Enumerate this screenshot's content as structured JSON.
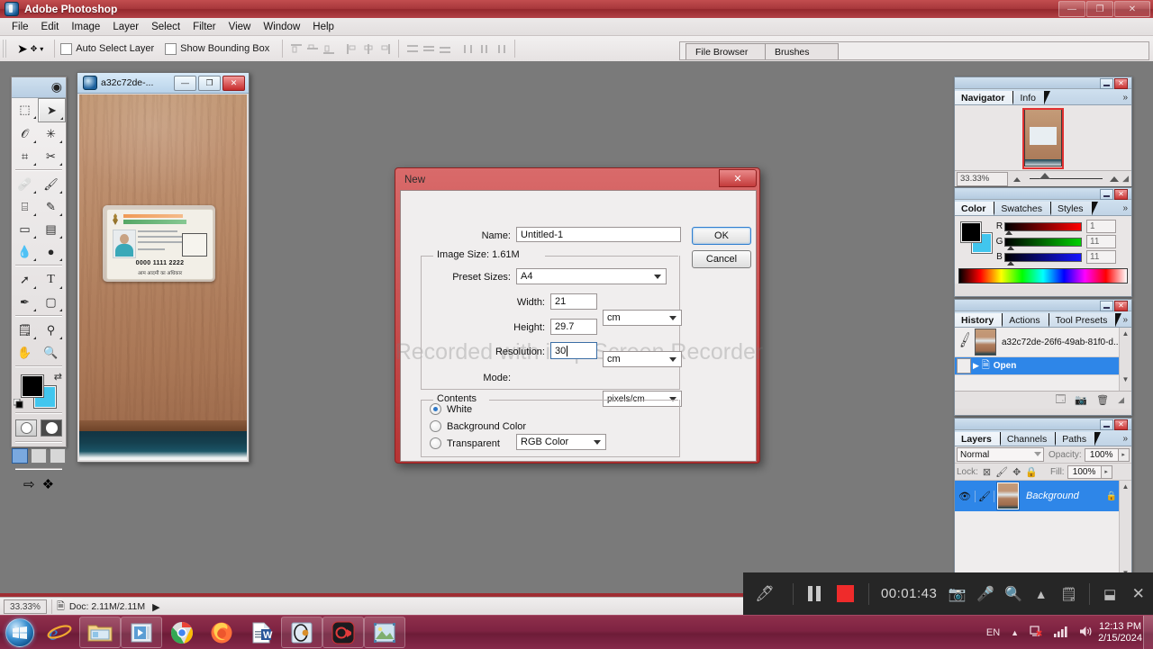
{
  "app": {
    "title": "Adobe Photoshop",
    "window_controls": {
      "minimize": "—",
      "restore": "❐",
      "close": "✕"
    },
    "menus": [
      "File",
      "Edit",
      "Image",
      "Layer",
      "Select",
      "Filter",
      "View",
      "Window",
      "Help"
    ]
  },
  "options_bar": {
    "auto_select_layer": "Auto Select Layer",
    "show_bounding_box": "Show Bounding Box"
  },
  "palette_well": {
    "tabs": [
      "File Browser",
      "Brushes"
    ]
  },
  "document": {
    "title": "a32c72de-...",
    "buttons": {
      "minimize": "—",
      "maximize": "❐",
      "close": "✕"
    },
    "id_card": {
      "number": "0000 1111 2222",
      "footer": "आम आदमी का अधिकार"
    }
  },
  "status_bar": {
    "zoom": "33.33%",
    "doc_info": "Doc: 2.11M/2.11M",
    "arrow": "▶"
  },
  "navigator": {
    "tabs": [
      "Navigator",
      "Info"
    ],
    "zoom": "33.33%",
    "more": "»"
  },
  "color": {
    "tabs": [
      "Color",
      "Swatches",
      "Styles"
    ],
    "more": "»",
    "channels": [
      {
        "label": "R",
        "value": "1"
      },
      {
        "label": "G",
        "value": "11"
      },
      {
        "label": "B",
        "value": "11"
      }
    ],
    "foreground_hex": "#000000",
    "background_hex": "#41c6ee"
  },
  "history": {
    "tabs": [
      "History",
      "Actions",
      "Tool Presets"
    ],
    "more": "»",
    "snapshot": "a32c72de-26f6-49ab-81f0-d...",
    "selected_state": "Open"
  },
  "layers": {
    "tabs": [
      "Layers",
      "Channels",
      "Paths"
    ],
    "more": "»",
    "blend_mode": "Normal",
    "opacity_label": "Opacity:",
    "opacity_value": "100%",
    "lock_label": "Lock:",
    "fill_label": "Fill:",
    "fill_value": "100%",
    "rows": [
      {
        "name": "Background",
        "locked": true
      }
    ]
  },
  "dialog": {
    "title": "New",
    "close": "✕",
    "name_label": "Name:",
    "name_value": "Untitled-1",
    "image_size_label": "Image Size: 1.61M",
    "preset_label": "Preset Sizes:",
    "preset_value": "A4",
    "width_label": "Width:",
    "width_value": "21",
    "width_unit": "cm",
    "height_label": "Height:",
    "height_value": "29.7",
    "height_unit": "cm",
    "resolution_label": "Resolution:",
    "resolution_value": "30",
    "resolution_unit": "pixels/cm",
    "mode_label": "Mode:",
    "mode_value": "RGB Color",
    "contents_label": "Contents",
    "contents_options": [
      "White",
      "Background Color",
      "Transparent"
    ],
    "contents_selected": "White",
    "ok": "OK",
    "cancel": "Cancel",
    "watermark": "Recorded with iTop Screen Recorder"
  },
  "recorder": {
    "elapsed": "00:01:43"
  },
  "taskbar": {
    "language": "EN",
    "time": "12:13 PM",
    "date": "2/15/2024"
  }
}
